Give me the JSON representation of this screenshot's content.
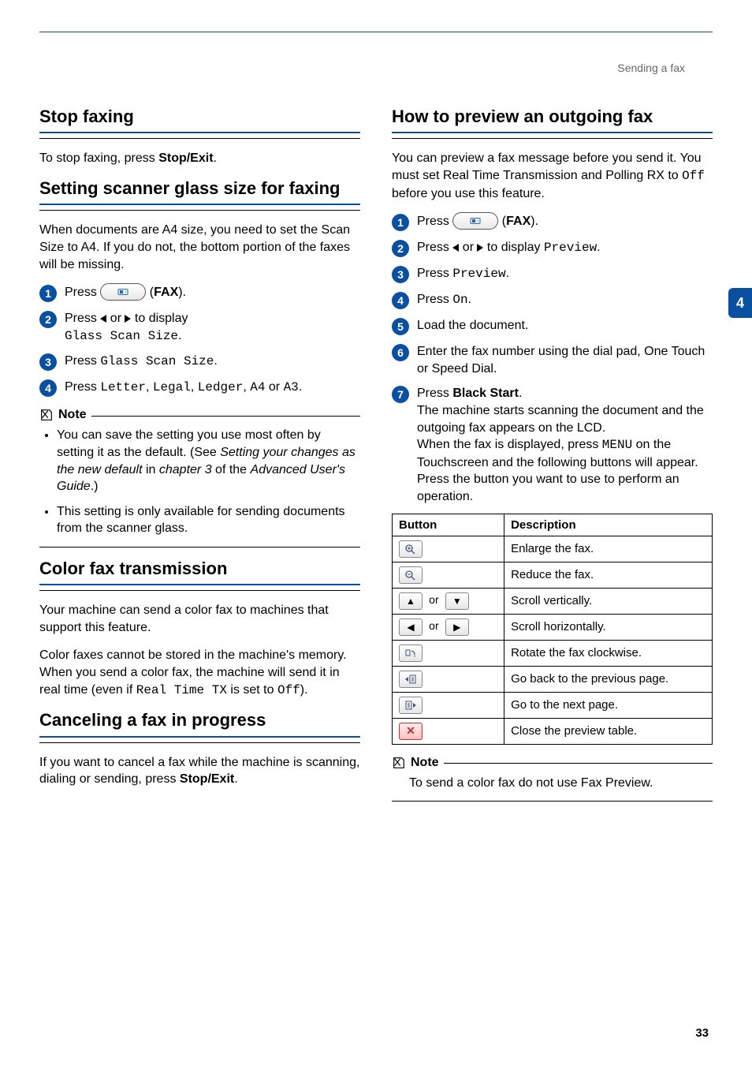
{
  "breadcrumb": "Sending a fax",
  "side_tab": "4",
  "page_number": "33",
  "left": {
    "h_stop": "Stop faxing",
    "p_stop_a": "To stop faxing, press ",
    "p_stop_b": "Stop/Exit",
    "p_stop_c": ".",
    "h_scanner": "Setting scanner glass size for faxing",
    "p_scanner": "When documents are A4 size, you need to set the Scan Size to A4. If you do not, the bottom portion of the faxes will be missing.",
    "steps_scanner": {
      "s1_a": "Press ",
      "s1_b": " (",
      "s1_c": "FAX",
      "s1_d": ").",
      "s2_a": "Press ",
      "s2_b": " or ",
      "s2_c": " to display ",
      "s2_d": "Glass Scan Size",
      "s2_e": ".",
      "s3_a": "Press ",
      "s3_b": "Glass Scan Size",
      "s3_c": ".",
      "s4_a": "Press ",
      "s4_b": "Letter",
      "s4_c": ", ",
      "s4_d": "Legal",
      "s4_e": ", ",
      "s4_f": "Ledger",
      "s4_g": ", ",
      "s4_h": "A4",
      "s4_i": " or ",
      "s4_j": "A3",
      "s4_k": "."
    },
    "note_label": "Note",
    "note_items": {
      "i1_a": "You can save the setting you use most often by setting it as the default. (See ",
      "i1_b": "Setting your changes as the new default",
      "i1_c": " in ",
      "i1_d": "chapter 3",
      "i1_e": " of the ",
      "i1_f": "Advanced User's Guide",
      "i1_g": ".)",
      "i2": "This setting is only available for sending documents from the scanner glass."
    },
    "h_color": "Color fax transmission",
    "p_color_1": "Your machine can send a color fax to machines that support this feature.",
    "p_color_2a": "Color faxes cannot be stored in the machine's memory. When you send a color fax, the machine will send it in real time (even if ",
    "p_color_2b": "Real Time TX",
    "p_color_2c": " is set to ",
    "p_color_2d": "Off",
    "p_color_2e": ").",
    "h_cancel": "Canceling a fax in progress",
    "p_cancel_a": "If you want to cancel a fax while the machine is scanning, dialing or sending, press ",
    "p_cancel_b": "Stop/Exit",
    "p_cancel_c": "."
  },
  "right": {
    "h_preview": "How to preview an outgoing fax",
    "p_preview_a": "You can preview a fax message before you send it. You must set Real Time Transmission and Polling RX to ",
    "p_preview_b": "Off",
    "p_preview_c": " before you use this feature.",
    "steps": {
      "s1_a": "Press ",
      "s1_b": " (",
      "s1_c": "FAX",
      "s1_d": ").",
      "s2_a": "Press ",
      "s2_b": " or ",
      "s2_c": " to display ",
      "s2_d": "Preview",
      "s2_e": ".",
      "s3_a": "Press ",
      "s3_b": "Preview",
      "s3_c": ".",
      "s4_a": "Press ",
      "s4_b": "On",
      "s4_c": ".",
      "s5": "Load the document.",
      "s6": "Enter the fax number using the dial pad, One Touch or Speed Dial.",
      "s7_a": "Press ",
      "s7_b": "Black Start",
      "s7_c": ".",
      "s7_d": "The machine starts scanning the document and the outgoing fax appears on the LCD.",
      "s7_e": "When the fax is displayed, press ",
      "s7_f": "MENU",
      "s7_g": " on the Touchscreen and the following buttons will appear. Press the button you want to use to perform an operation."
    },
    "table": {
      "h1": "Button",
      "h2": "Description",
      "r_or": "or",
      "rows": [
        "Enlarge the fax.",
        "Reduce the fax.",
        "Scroll vertically.",
        "Scroll horizontally.",
        "Rotate the fax clockwise.",
        "Go back to the previous page.",
        "Go to the next page.",
        "Close the preview table."
      ]
    },
    "note_label": "Note",
    "note_text": "To send a color fax do not use Fax Preview."
  }
}
